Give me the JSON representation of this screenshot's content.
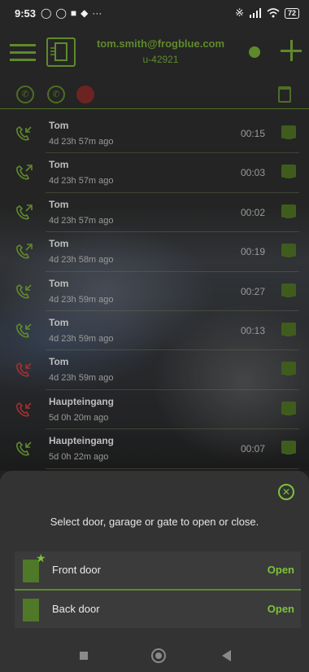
{
  "status_bar": {
    "time": "9:53",
    "icons": [
      "alarm-icon",
      "whatsapp-icon",
      "messages-icon",
      "shield-icon",
      "more-icon"
    ],
    "more": "···",
    "battery": "72"
  },
  "header": {
    "email": "tom.smith@frogblue.com",
    "user_id": "u-42921"
  },
  "calls": [
    {
      "name": "Tom",
      "ago": "4d 23h 57m ago",
      "duration": "00:15",
      "type": "incoming"
    },
    {
      "name": "Tom",
      "ago": "4d 23h 57m ago",
      "duration": "00:03",
      "type": "outgoing"
    },
    {
      "name": "Tom",
      "ago": "4d 23h 57m ago",
      "duration": "00:02",
      "type": "outgoing"
    },
    {
      "name": "Tom",
      "ago": "4d 23h 58m ago",
      "duration": "00:19",
      "type": "outgoing"
    },
    {
      "name": "Tom",
      "ago": "4d 23h 59m ago",
      "duration": "00:27",
      "type": "incoming"
    },
    {
      "name": "Tom",
      "ago": "4d 23h 59m ago",
      "duration": "00:13",
      "type": "incoming"
    },
    {
      "name": "Tom",
      "ago": "4d 23h 59m ago",
      "duration": "",
      "type": "missed"
    },
    {
      "name": "Haupteingang",
      "ago": "5d 0h 20m ago",
      "duration": "",
      "type": "missed"
    },
    {
      "name": "Haupteingang",
      "ago": "5d 0h 22m ago",
      "duration": "00:07",
      "type": "incoming"
    }
  ],
  "sheet": {
    "prompt": "Select door, garage or gate to open or close.",
    "doors": [
      {
        "label": "Front door",
        "action": "Open",
        "favorite": true
      },
      {
        "label": "Back door",
        "action": "Open",
        "favorite": false
      }
    ]
  },
  "colors": {
    "accent": "#5f8a2b",
    "open_green": "#7dc23a",
    "missed_red": "#a33030"
  }
}
